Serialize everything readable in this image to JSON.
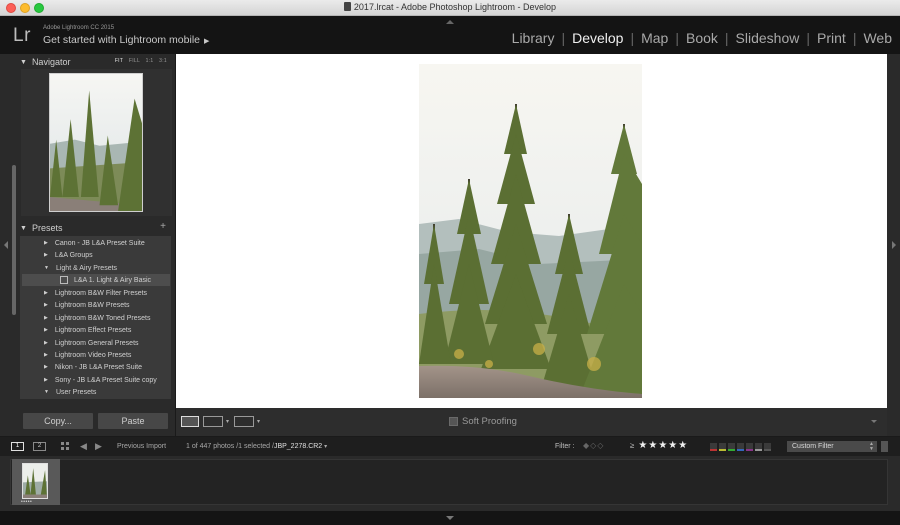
{
  "window": {
    "title": "2017.lrcat - Adobe Photoshop Lightroom - Develop"
  },
  "identity": {
    "app_version": "Adobe Lightroom CC 2015",
    "mobile_prompt": "Get started with Lightroom mobile"
  },
  "modules": {
    "items": [
      "Library",
      "Develop",
      "Map",
      "Book",
      "Slideshow",
      "Print",
      "Web"
    ],
    "active": "Develop"
  },
  "navigator": {
    "title": "Navigator",
    "zoom": [
      "FIT",
      "FILL",
      "1:1",
      "3:1"
    ],
    "active_zoom": "FIT"
  },
  "presets": {
    "title": "Presets",
    "add_symbol": "+",
    "items": [
      {
        "label": "Canon - JB L&A Preset Suite",
        "expanded": false
      },
      {
        "label": "L&A Groups",
        "expanded": false
      },
      {
        "label": "Light & Airy Presets",
        "expanded": true
      },
      {
        "label": "L&A 1. Light & Airy Basic",
        "child": true
      },
      {
        "label": "Lightroom B&W Filter Presets",
        "expanded": false
      },
      {
        "label": "Lightroom B&W Presets",
        "expanded": false
      },
      {
        "label": "Lightroom B&W Toned Presets",
        "expanded": false
      },
      {
        "label": "Lightroom Effect Presets",
        "expanded": false
      },
      {
        "label": "Lightroom General Presets",
        "expanded": false
      },
      {
        "label": "Lightroom Video Presets",
        "expanded": false
      },
      {
        "label": "Nikon - JB L&A Preset Suite",
        "expanded": false
      },
      {
        "label": "Sony - JB L&A Preset Suite copy",
        "expanded": false
      },
      {
        "label": "User Presets",
        "expanded": true
      }
    ]
  },
  "left_buttons": {
    "copy": "Copy...",
    "paste": "Paste"
  },
  "toolbar": {
    "soft_proofing": "Soft Proofing"
  },
  "filmstrip_bar": {
    "page1": "1",
    "page2": "2",
    "source": "Previous Import",
    "count": "1 of 447 photos /1 selected /",
    "filename": "JBP_2278.CR2",
    "filter_label": "Filter :",
    "rating_op": "≥",
    "stars": "★★★★★",
    "custom_filter": "Custom Filter"
  },
  "filmstrip": {
    "thumb_rating": "•••••"
  },
  "colors": {
    "panel_bg": "#2a2a2a",
    "topbar_bg": "#141414",
    "canvas_bg": "#ffffff",
    "active_text": "#f0f0f0"
  }
}
